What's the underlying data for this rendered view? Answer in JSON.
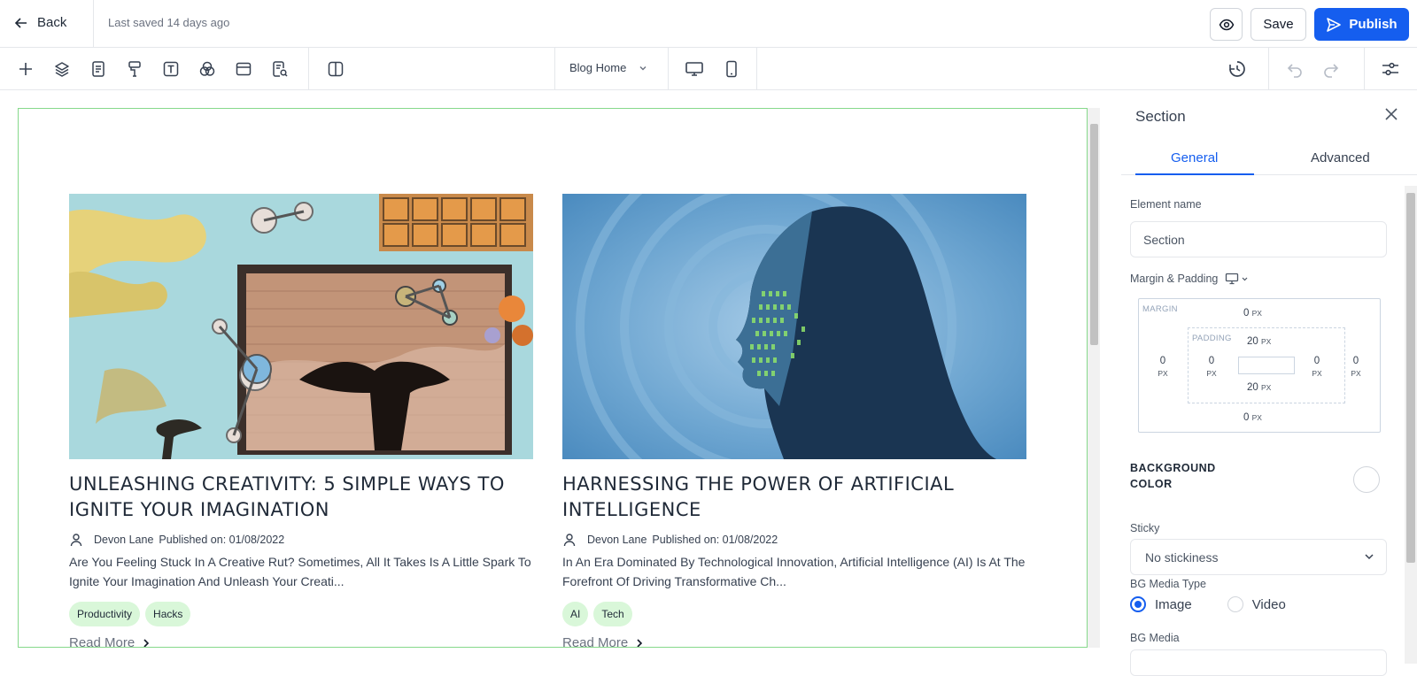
{
  "header": {
    "back_label": "Back",
    "last_saved": "Last saved 14 days ago",
    "save_label": "Save",
    "publish_label": "Publish"
  },
  "toolbar": {
    "page_select": "Blog Home"
  },
  "posts": [
    {
      "title": "UNLEASHING CREATIVITY: 5 SIMPLE WAYS TO IGNITE YOUR IMAGINATION",
      "author": "Devon Lane",
      "published": "Published on: 01/08/2022",
      "excerpt": "Are You Feeling Stuck In A Creative Rut? Sometimes, All It Takes Is A Little Spark To Ignite Your Imagination And Unleash Your Creati...",
      "tags": [
        "Productivity",
        "Hacks"
      ],
      "read_more": "Read More"
    },
    {
      "title": "HARNESSING THE POWER OF ARTIFICIAL INTELLIGENCE",
      "author": "Devon Lane",
      "published": "Published on: 01/08/2022",
      "excerpt": "In An Era Dominated By Technological Innovation, Artificial Intelligence (AI) Is At The Forefront Of Driving Transformative Ch...",
      "tags": [
        "AI",
        "Tech"
      ],
      "read_more": "Read More"
    }
  ],
  "panel": {
    "title": "Section",
    "tabs": [
      "General",
      "Advanced"
    ],
    "element_name_label": "Element name",
    "element_name_value": "Section",
    "margin_padding_label": "Margin & Padding",
    "margin_label": "MARGIN",
    "padding_label": "PADDING",
    "margin": {
      "top": "0",
      "right": "0",
      "bottom": "0",
      "left": "0"
    },
    "padding": {
      "top": "20",
      "right": "0",
      "bottom": "20",
      "left": "0"
    },
    "unit": "PX",
    "bg_color_label": "BACKGROUND COLOR",
    "sticky_label": "Sticky",
    "sticky_value": "No stickiness",
    "bg_media_type_label": "BG Media Type",
    "bg_media_options": [
      "Image",
      "Video"
    ],
    "bg_media_selected": "Image",
    "bg_media_label": "BG Media"
  },
  "colors": {
    "accent": "#155eef",
    "canvas_border": "#86d98b",
    "tag_bg": "#d9f7d9"
  }
}
